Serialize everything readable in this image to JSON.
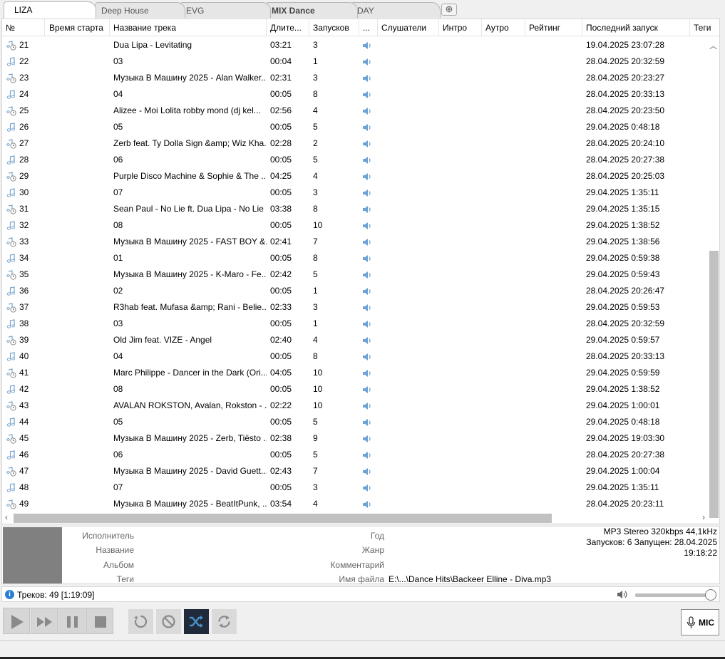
{
  "tabs": [
    "LIZA",
    "Deep House",
    "EVG",
    "MIX Dance",
    "DAY"
  ],
  "columns": [
    "№",
    "Время старта",
    "Название трека",
    "Длите...",
    "Запусков",
    "...",
    "Слушатели",
    "Интро",
    "Аутро",
    "Рейтинг",
    "Последний запуск",
    "Теги"
  ],
  "rows": [
    {
      "num": "21",
      "start": "",
      "title": "Dua Lipa - Levitating",
      "dur": "03:21",
      "plays": "3",
      "last": "19.04.2025 23:07:28",
      "icon": "note-clock-icon"
    },
    {
      "num": "22",
      "start": "",
      "title": "03",
      "dur": "00:04",
      "plays": "1",
      "last": "28.04.2025 20:32:59",
      "icon": "note-icon"
    },
    {
      "num": "23",
      "start": "",
      "title": "Музыка В Машину 2025 - Alan Walker...",
      "dur": "02:31",
      "plays": "3",
      "last": "28.04.2025 20:23:27",
      "icon": "note-clock-icon"
    },
    {
      "num": "24",
      "start": "",
      "title": "04",
      "dur": "00:05",
      "plays": "8",
      "last": "28.04.2025 20:33:13",
      "icon": "note-icon"
    },
    {
      "num": "25",
      "start": "",
      "title": "Alizee - Moi Lolita robby mond (dj kel...",
      "dur": "02:56",
      "plays": "4",
      "last": "28.04.2025 20:23:50",
      "icon": "note-clock-icon"
    },
    {
      "num": "26",
      "start": "",
      "title": "05",
      "dur": "00:05",
      "plays": "5",
      "last": "29.04.2025 0:48:18",
      "icon": "note-icon"
    },
    {
      "num": "27",
      "start": "",
      "title": "Zerb feat. Ty Dolla Sign &amp; Wiz Kha...",
      "dur": "02:28",
      "plays": "2",
      "last": "28.04.2025 20:24:10",
      "icon": "note-clock-icon"
    },
    {
      "num": "28",
      "start": "",
      "title": "06",
      "dur": "00:05",
      "plays": "5",
      "last": "28.04.2025 20:27:38",
      "icon": "note-icon"
    },
    {
      "num": "29",
      "start": "",
      "title": "Purple Disco Machine & Sophie & The ...",
      "dur": "04:25",
      "plays": "4",
      "last": "28.04.2025 20:25:03",
      "icon": "note-clock-icon"
    },
    {
      "num": "30",
      "start": "",
      "title": "07",
      "dur": "00:05",
      "plays": "3",
      "last": "29.04.2025 1:35:11",
      "icon": "note-icon"
    },
    {
      "num": "31",
      "start": "",
      "title": "Sean Paul - No Lie ft. Dua Lipa - No Lie",
      "dur": "03:38",
      "plays": "8",
      "last": "29.04.2025 1:35:15",
      "icon": "note-clock-icon"
    },
    {
      "num": "32",
      "start": "",
      "title": "08",
      "dur": "00:05",
      "plays": "10",
      "last": "29.04.2025 1:38:52",
      "icon": "note-icon"
    },
    {
      "num": "33",
      "start": "",
      "title": "Музыка В Машину 2025 - FAST BOY &...",
      "dur": "02:41",
      "plays": "7",
      "last": "29.04.2025 1:38:56",
      "icon": "note-clock-icon"
    },
    {
      "num": "34",
      "start": "",
      "title": "01",
      "dur": "00:05",
      "plays": "8",
      "last": "29.04.2025 0:59:38",
      "icon": "note-icon"
    },
    {
      "num": "35",
      "start": "",
      "title": "Музыка В Машину 2025 - K-Maro - Fe...",
      "dur": "02:42",
      "plays": "5",
      "last": "29.04.2025 0:59:43",
      "icon": "note-clock-icon"
    },
    {
      "num": "36",
      "start": "",
      "title": "02",
      "dur": "00:05",
      "plays": "1",
      "last": "28.04.2025 20:26:47",
      "icon": "note-icon"
    },
    {
      "num": "37",
      "start": "",
      "title": "R3hab feat. Mufasa &amp; Rani - Belie...",
      "dur": "02:33",
      "plays": "3",
      "last": "29.04.2025 0:59:53",
      "icon": "note-clock-icon"
    },
    {
      "num": "38",
      "start": "",
      "title": "03",
      "dur": "00:05",
      "plays": "1",
      "last": "28.04.2025 20:32:59",
      "icon": "note-icon"
    },
    {
      "num": "39",
      "start": "",
      "title": "Old Jim feat. VIZE - Angel",
      "dur": "02:40",
      "plays": "4",
      "last": "29.04.2025 0:59:57",
      "icon": "note-clock-icon"
    },
    {
      "num": "40",
      "start": "",
      "title": "04",
      "dur": "00:05",
      "plays": "8",
      "last": "28.04.2025 20:33:13",
      "icon": "note-icon"
    },
    {
      "num": "41",
      "start": "",
      "title": "Marc Philippe - Dancer in the Dark (Ori...",
      "dur": "04:05",
      "plays": "10",
      "last": "29.04.2025 0:59:59",
      "icon": "note-clock-icon"
    },
    {
      "num": "42",
      "start": "",
      "title": "08",
      "dur": "00:05",
      "plays": "10",
      "last": "29.04.2025 1:38:52",
      "icon": "note-icon"
    },
    {
      "num": "43",
      "start": "",
      "title": "AVALAN ROKSTON, Avalan, Rokston - ...",
      "dur": "02:22",
      "plays": "10",
      "last": "29.04.2025 1:00:01",
      "icon": "note-clock-icon"
    },
    {
      "num": "44",
      "start": "",
      "title": "05",
      "dur": "00:05",
      "plays": "5",
      "last": "29.04.2025 0:48:18",
      "icon": "note-icon"
    },
    {
      "num": "45",
      "start": "",
      "title": "Музыка В Машину 2025 - Zerb, Tiësto ...",
      "dur": "02:38",
      "plays": "9",
      "last": "29.04.2025 19:03:30",
      "icon": "note-clock-icon"
    },
    {
      "num": "46",
      "start": "",
      "title": "06",
      "dur": "00:05",
      "plays": "5",
      "last": "28.04.2025 20:27:38",
      "icon": "note-icon"
    },
    {
      "num": "47",
      "start": "",
      "title": "Музыка В Машину 2025 - David Guett...",
      "dur": "02:43",
      "plays": "7",
      "last": "29.04.2025 1:00:04",
      "icon": "note-clock-icon"
    },
    {
      "num": "48",
      "start": "",
      "title": "07",
      "dur": "00:05",
      "plays": "3",
      "last": "29.04.2025 1:35:11",
      "icon": "note-icon"
    },
    {
      "num": "49",
      "start": "",
      "title": "Музыка В Машину 2025 - BeatItPunk, ...",
      "dur": "03:54",
      "plays": "4",
      "last": "28.04.2025 20:23:11",
      "icon": "note-clock-icon"
    }
  ],
  "info": {
    "labels": {
      "artist": "Исполнитель",
      "title": "Название",
      "album": "Альбом",
      "tags": "Теги",
      "year": "Год",
      "genre": "Жанр",
      "comment": "Комментарий",
      "filename": "Имя файла"
    },
    "filename": "E:\\...\\Dance Hits\\Backeer Elline - Diva.mp3",
    "format": "MP3 Stereo 320kbps 44,1kHz",
    "plays": "Запусков: 6  Запущен: 28.04.2025",
    "time": "19:18:22"
  },
  "status": {
    "tracks": "Треков: 49 [1:19:09]",
    "volume_fraction": 0.95
  },
  "mic_label": "MIC",
  "colors": {
    "active_mode": "#202a3a",
    "icon_blue": "#4a90c8",
    "cover": "#808080"
  },
  "icons": [
    "play-icon",
    "fast-forward-icon",
    "pause-icon",
    "stop-icon",
    "repeat-icon",
    "disable-icon",
    "shuffle-icon",
    "loop-icon",
    "microphone-icon",
    "speaker-icon"
  ]
}
